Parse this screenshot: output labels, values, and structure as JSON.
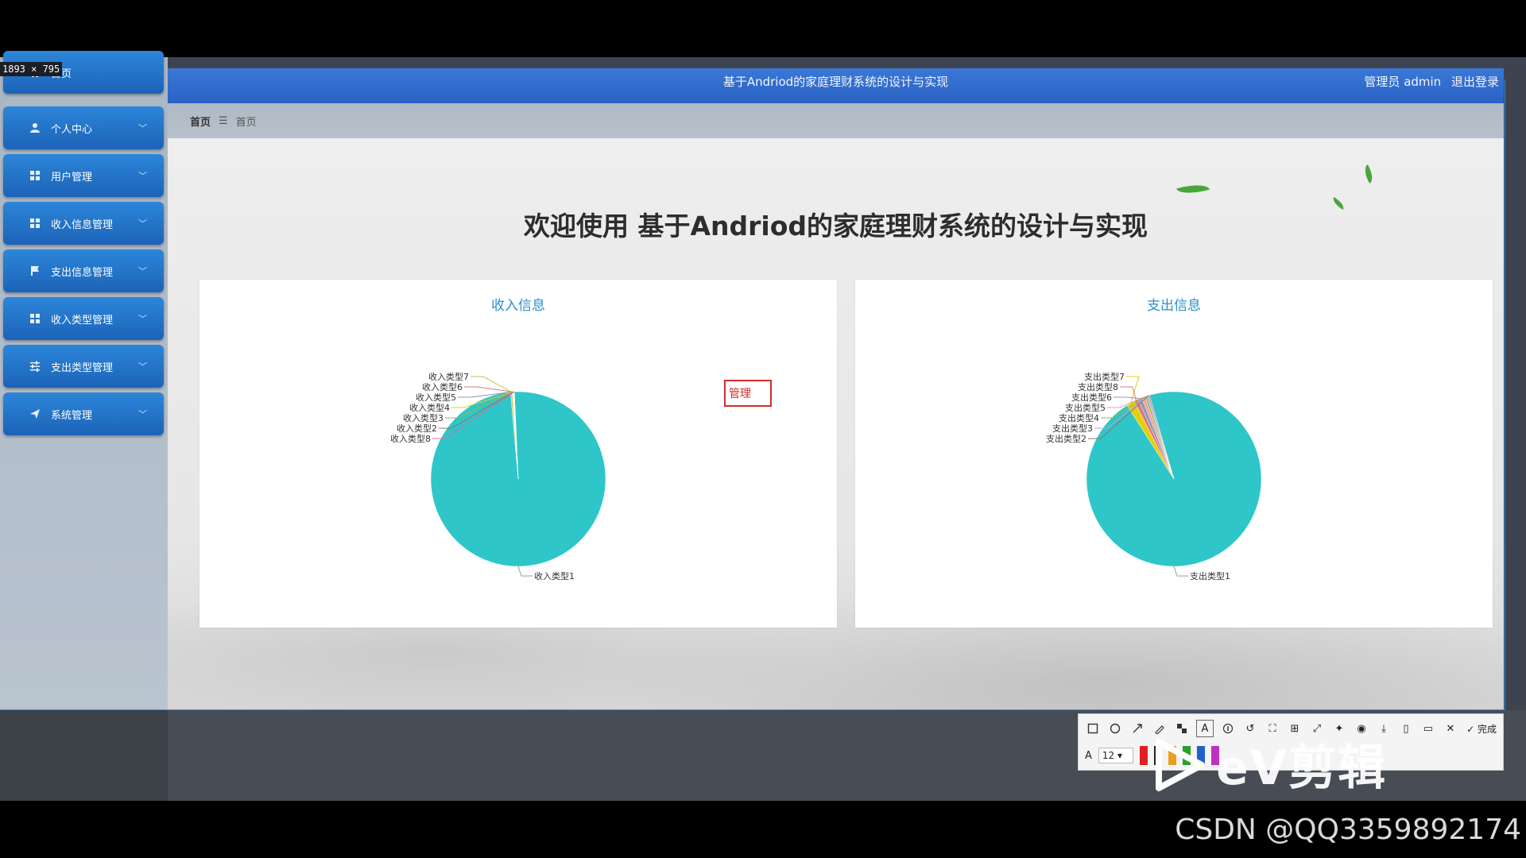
{
  "screen_size_label": "1893 × 795",
  "header": {
    "title": "基于Andriod的家庭理财系统的设计与实现",
    "user_label": "管理员 admin",
    "logout_label": "退出登录"
  },
  "sidebar": {
    "items": [
      {
        "label": "首页",
        "icon": "home-icon"
      },
      {
        "label": "个人中心",
        "icon": "user-icon"
      },
      {
        "label": "用户管理",
        "icon": "grid-icon"
      },
      {
        "label": "收入信息管理",
        "icon": "grid-icon"
      },
      {
        "label": "支出信息管理",
        "icon": "flag-icon"
      },
      {
        "label": "收入类型管理",
        "icon": "grid-icon"
      },
      {
        "label": "支出类型管理",
        "icon": "sliders-icon"
      },
      {
        "label": "系统管理",
        "icon": "send-icon"
      }
    ]
  },
  "breadcrumb": {
    "home": "首页",
    "separator": "☰",
    "current": "首页"
  },
  "welcome": "欢迎使用 基于Andriod的家庭理财系统的设计与实现",
  "annotation_box_text": "管理",
  "chart_data": [
    {
      "type": "pie",
      "title": "收入信息",
      "labels": [
        "收入类型1",
        "收入类型7",
        "收入类型6",
        "收入类型5",
        "收入类型4",
        "收入类型3",
        "收入类型2",
        "收入类型8"
      ],
      "values": [
        99.3,
        0.3,
        0.1,
        0.1,
        0.05,
        0.05,
        0.05,
        0.05
      ],
      "colors": [
        "#2ec6c8",
        "#c9c24c",
        "#d87a80",
        "#8d98b3",
        "#e5cf0d",
        "#97b552",
        "#95706d",
        "#dc69aa"
      ]
    },
    {
      "type": "pie",
      "title": "支出信息",
      "labels": [
        "支出类型1",
        "支出类型7",
        "支出类型8",
        "支出类型6",
        "支出类型5",
        "支出类型4",
        "支出类型3",
        "支出类型2"
      ],
      "values": [
        95.5,
        1.5,
        0.8,
        0.7,
        0.6,
        0.4,
        0.3,
        0.2
      ],
      "colors": [
        "#2ec6c8",
        "#e5cf0d",
        "#d87a80",
        "#8d98b3",
        "#f0a0a0",
        "#97b552",
        "#b6a2de",
        "#95706d"
      ]
    }
  ],
  "toolbar": {
    "done_label": "完成",
    "font_label": "A",
    "font_size": "12"
  },
  "watermark_logo": "eV剪辑",
  "watermark_text": "CSDN @QQ3359892174"
}
